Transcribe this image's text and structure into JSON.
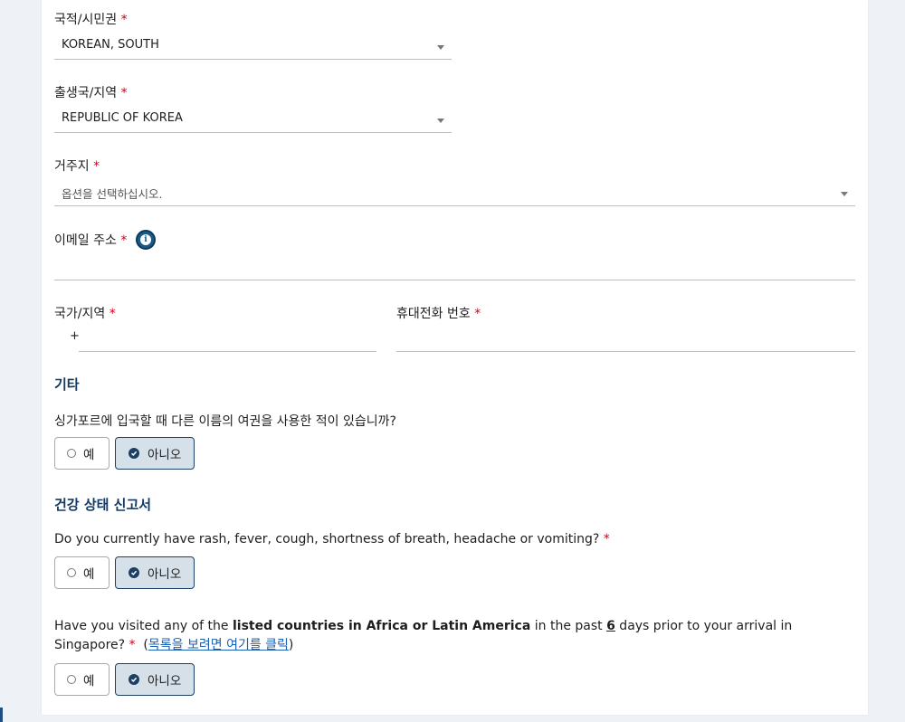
{
  "form": {
    "nationality": {
      "label": "국적/시민권",
      "required": "*",
      "value": "KOREAN, SOUTH"
    },
    "birth_country": {
      "label": "출생국/지역",
      "required": "*",
      "value": "REPUBLIC OF KOREA"
    },
    "residence": {
      "label": "거주지",
      "required": "*",
      "placeholder": "옵션을 선택하십시오."
    },
    "email": {
      "label": "이메일 주소",
      "required": "*",
      "value": ""
    },
    "country_code": {
      "label": "국가/지역",
      "required": "*",
      "prefix": "+",
      "value": ""
    },
    "mobile": {
      "label": "휴대전화 번호",
      "required": "*",
      "value": ""
    }
  },
  "other": {
    "title": "기타",
    "question": "싱가포르에 입국할 때 다른 이름의 여권을 사용한 적이 있습니까?",
    "yes": "예",
    "no": "아니오",
    "selected": "no"
  },
  "health": {
    "title": "건강 상태 신고서",
    "q1": {
      "text": "Do you currently have rash, fever, cough, shortness of breath, headache or vomiting?",
      "required": "*",
      "yes": "예",
      "no": "아니오",
      "selected": "no"
    },
    "q2": {
      "prefix": "Have you visited any of the ",
      "bold": "listed countries in Africa or Latin America",
      "mid": " in the past ",
      "days": "6",
      "suffix": " days prior to your arrival in Singapore?",
      "required": "*",
      "link_open": "(",
      "link": "목록을 보려면 여기를 클릭",
      "link_close": ")",
      "yes": "예",
      "no": "아니오",
      "selected": "no"
    }
  },
  "colors": {
    "accent": "#1c3f63",
    "required": "#d0021b",
    "selected_bg": "#d5e0e9",
    "link": "#1a5fb4"
  },
  "icons": {
    "info": "info-icon",
    "select_caret": "chevron-down-icon",
    "selected": "check-circle-icon",
    "unselected": "radio-empty-icon"
  }
}
